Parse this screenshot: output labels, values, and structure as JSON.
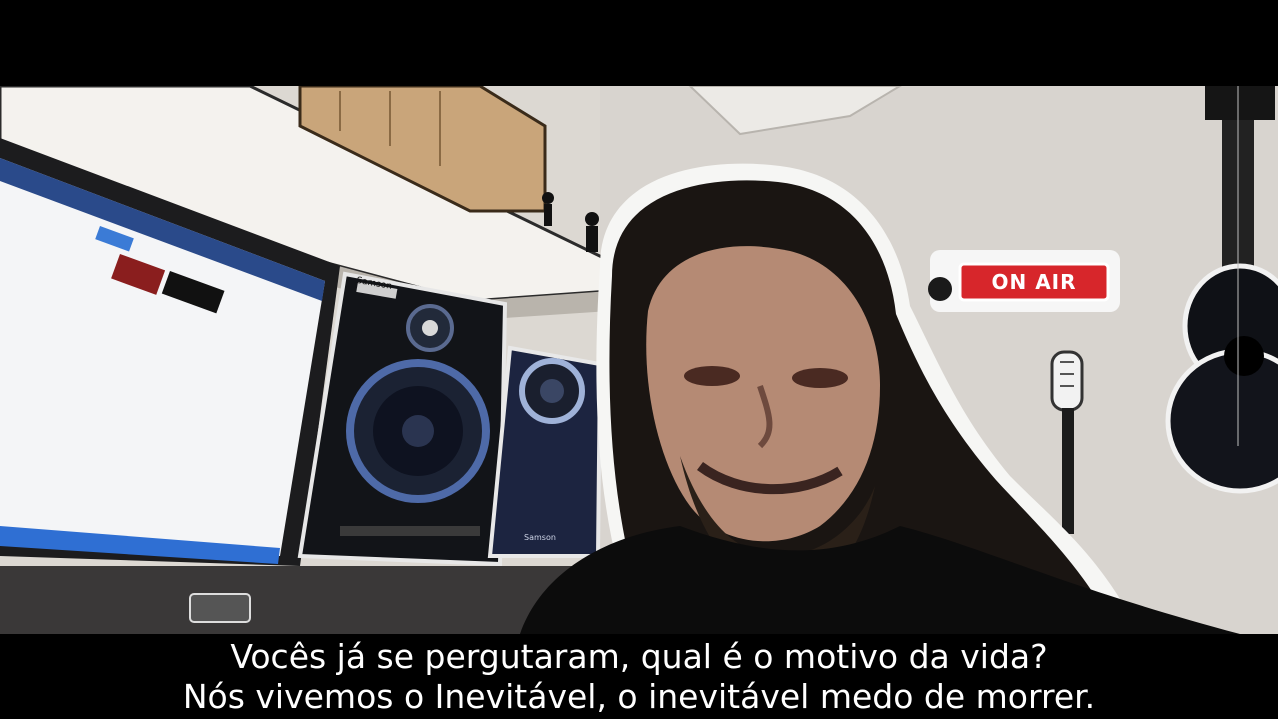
{
  "video": {
    "sign_text": "ON AIR",
    "speaker_label_left": "Samson",
    "speaker_label_right": "Samson"
  },
  "subtitles": {
    "line1": "Vocês já se pergutaram, qual é o motivo da vida?",
    "line2": "Nós vivemos o Inevitável, o inevitável medo de morrer."
  },
  "colors": {
    "letterbox": "#000000",
    "subtitle_text": "#ffffff",
    "sign_red": "#d7262b",
    "wall": "#dcd7d1"
  }
}
